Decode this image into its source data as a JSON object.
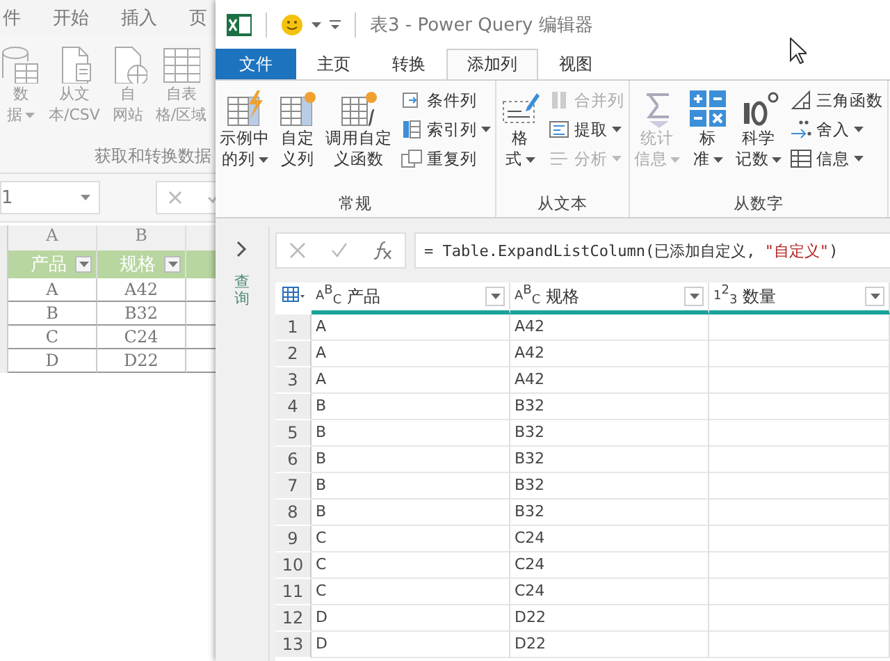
{
  "excel": {
    "tabs": [
      "件",
      "开始",
      "插入",
      "页"
    ],
    "ribbon_buttons": [
      {
        "lines": [
          "数",
          "据"
        ],
        "dropdown": true
      },
      {
        "lines": [
          "从文",
          "本/CSV"
        ],
        "dropdown": false
      },
      {
        "lines": [
          "自",
          "网站"
        ],
        "dropdown": false
      },
      {
        "lines": [
          "自表",
          "格/区域"
        ],
        "dropdown": false
      }
    ],
    "group_label": "获取和转换数据",
    "name_box": "1",
    "column_headers": [
      "A",
      "B"
    ],
    "table": {
      "columns": [
        "产品",
        "规格"
      ],
      "rows": [
        [
          "A",
          "A42"
        ],
        [
          "B",
          "B32"
        ],
        [
          "C",
          "C24"
        ],
        [
          "D",
          "D22"
        ]
      ]
    }
  },
  "pq": {
    "title": "表3 - Power Query 编辑器",
    "tabs": [
      {
        "label": "文件",
        "kind": "file",
        "selected": false
      },
      {
        "label": "主页",
        "kind": "tab",
        "selected": false
      },
      {
        "label": "转换",
        "kind": "tab",
        "selected": false
      },
      {
        "label": "添加列",
        "kind": "tab",
        "selected": true
      },
      {
        "label": "视图",
        "kind": "tab",
        "selected": false
      }
    ],
    "groups": [
      {
        "label": "常规",
        "items": [
          {
            "lines": [
              "示例中",
              "的列"
            ],
            "kind": "large",
            "dropdown": true,
            "disabled": false
          },
          {
            "lines": [
              "自定",
              "义列"
            ],
            "kind": "large",
            "dropdown": false,
            "disabled": false
          },
          {
            "lines": [
              "调用自定",
              "义函数"
            ],
            "kind": "large",
            "dropdown": false,
            "disabled": false
          },
          {
            "label": "条件列",
            "kind": "small",
            "dropdown": false,
            "disabled": false
          },
          {
            "label": "索引列",
            "kind": "small",
            "dropdown": true,
            "disabled": false
          },
          {
            "label": "重复列",
            "kind": "small",
            "dropdown": false,
            "disabled": false
          }
        ]
      },
      {
        "label": "从文本",
        "items": [
          {
            "lines": [
              "格",
              "式"
            ],
            "kind": "large",
            "dropdown": true,
            "disabled": false
          },
          {
            "label": "合并列",
            "kind": "small",
            "dropdown": false,
            "disabled": true
          },
          {
            "label": "提取",
            "kind": "small",
            "dropdown": true,
            "disabled": false
          },
          {
            "label": "分析",
            "kind": "small",
            "dropdown": true,
            "disabled": true
          }
        ]
      },
      {
        "label": "从数字",
        "items": [
          {
            "lines": [
              "统计",
              "信息"
            ],
            "kind": "large",
            "dropdown": true,
            "disabled": true
          },
          {
            "lines": [
              "标",
              "准"
            ],
            "kind": "large",
            "dropdown": true,
            "disabled": false
          },
          {
            "lines": [
              "科学",
              "记数"
            ],
            "kind": "large",
            "dropdown": true,
            "disabled": false
          },
          {
            "label": "三角函数",
            "kind": "small",
            "dropdown": false,
            "disabled": false
          },
          {
            "label": "舍入",
            "kind": "small",
            "dropdown": true,
            "disabled": false
          },
          {
            "label": "信息",
            "kind": "small",
            "dropdown": true,
            "disabled": false
          }
        ]
      }
    ],
    "query_pane_label": "查询",
    "formula": [
      {
        "text": "= Table.ExpandListColumn(已添加自定义, ",
        "kind": "code"
      },
      {
        "text": "\"自定义\"",
        "kind": "string"
      },
      {
        "text": ")",
        "kind": "code"
      }
    ],
    "columns": [
      {
        "type": "ABC",
        "label": "产品"
      },
      {
        "type": "ABC",
        "label": "规格"
      },
      {
        "type": "123",
        "label": "数量"
      }
    ],
    "rows": [
      {
        "number": "1",
        "cells": [
          "A",
          "A42"
        ]
      },
      {
        "number": "2",
        "cells": [
          "A",
          "A42"
        ]
      },
      {
        "number": "3",
        "cells": [
          "A",
          "A42"
        ]
      },
      {
        "number": "4",
        "cells": [
          "B",
          "B32"
        ]
      },
      {
        "number": "5",
        "cells": [
          "B",
          "B32"
        ]
      },
      {
        "number": "6",
        "cells": [
          "B",
          "B32"
        ]
      },
      {
        "number": "7",
        "cells": [
          "B",
          "B32"
        ]
      },
      {
        "number": "8",
        "cells": [
          "B",
          "B32"
        ]
      },
      {
        "number": "9",
        "cells": [
          "C",
          "C24"
        ]
      },
      {
        "number": "10",
        "cells": [
          "C",
          "C24"
        ]
      },
      {
        "number": "11",
        "cells": [
          "C",
          "C24"
        ]
      },
      {
        "number": "12",
        "cells": [
          "D",
          "D22"
        ]
      },
      {
        "number": "13",
        "cells": [
          "D",
          "D22"
        ]
      }
    ]
  }
}
